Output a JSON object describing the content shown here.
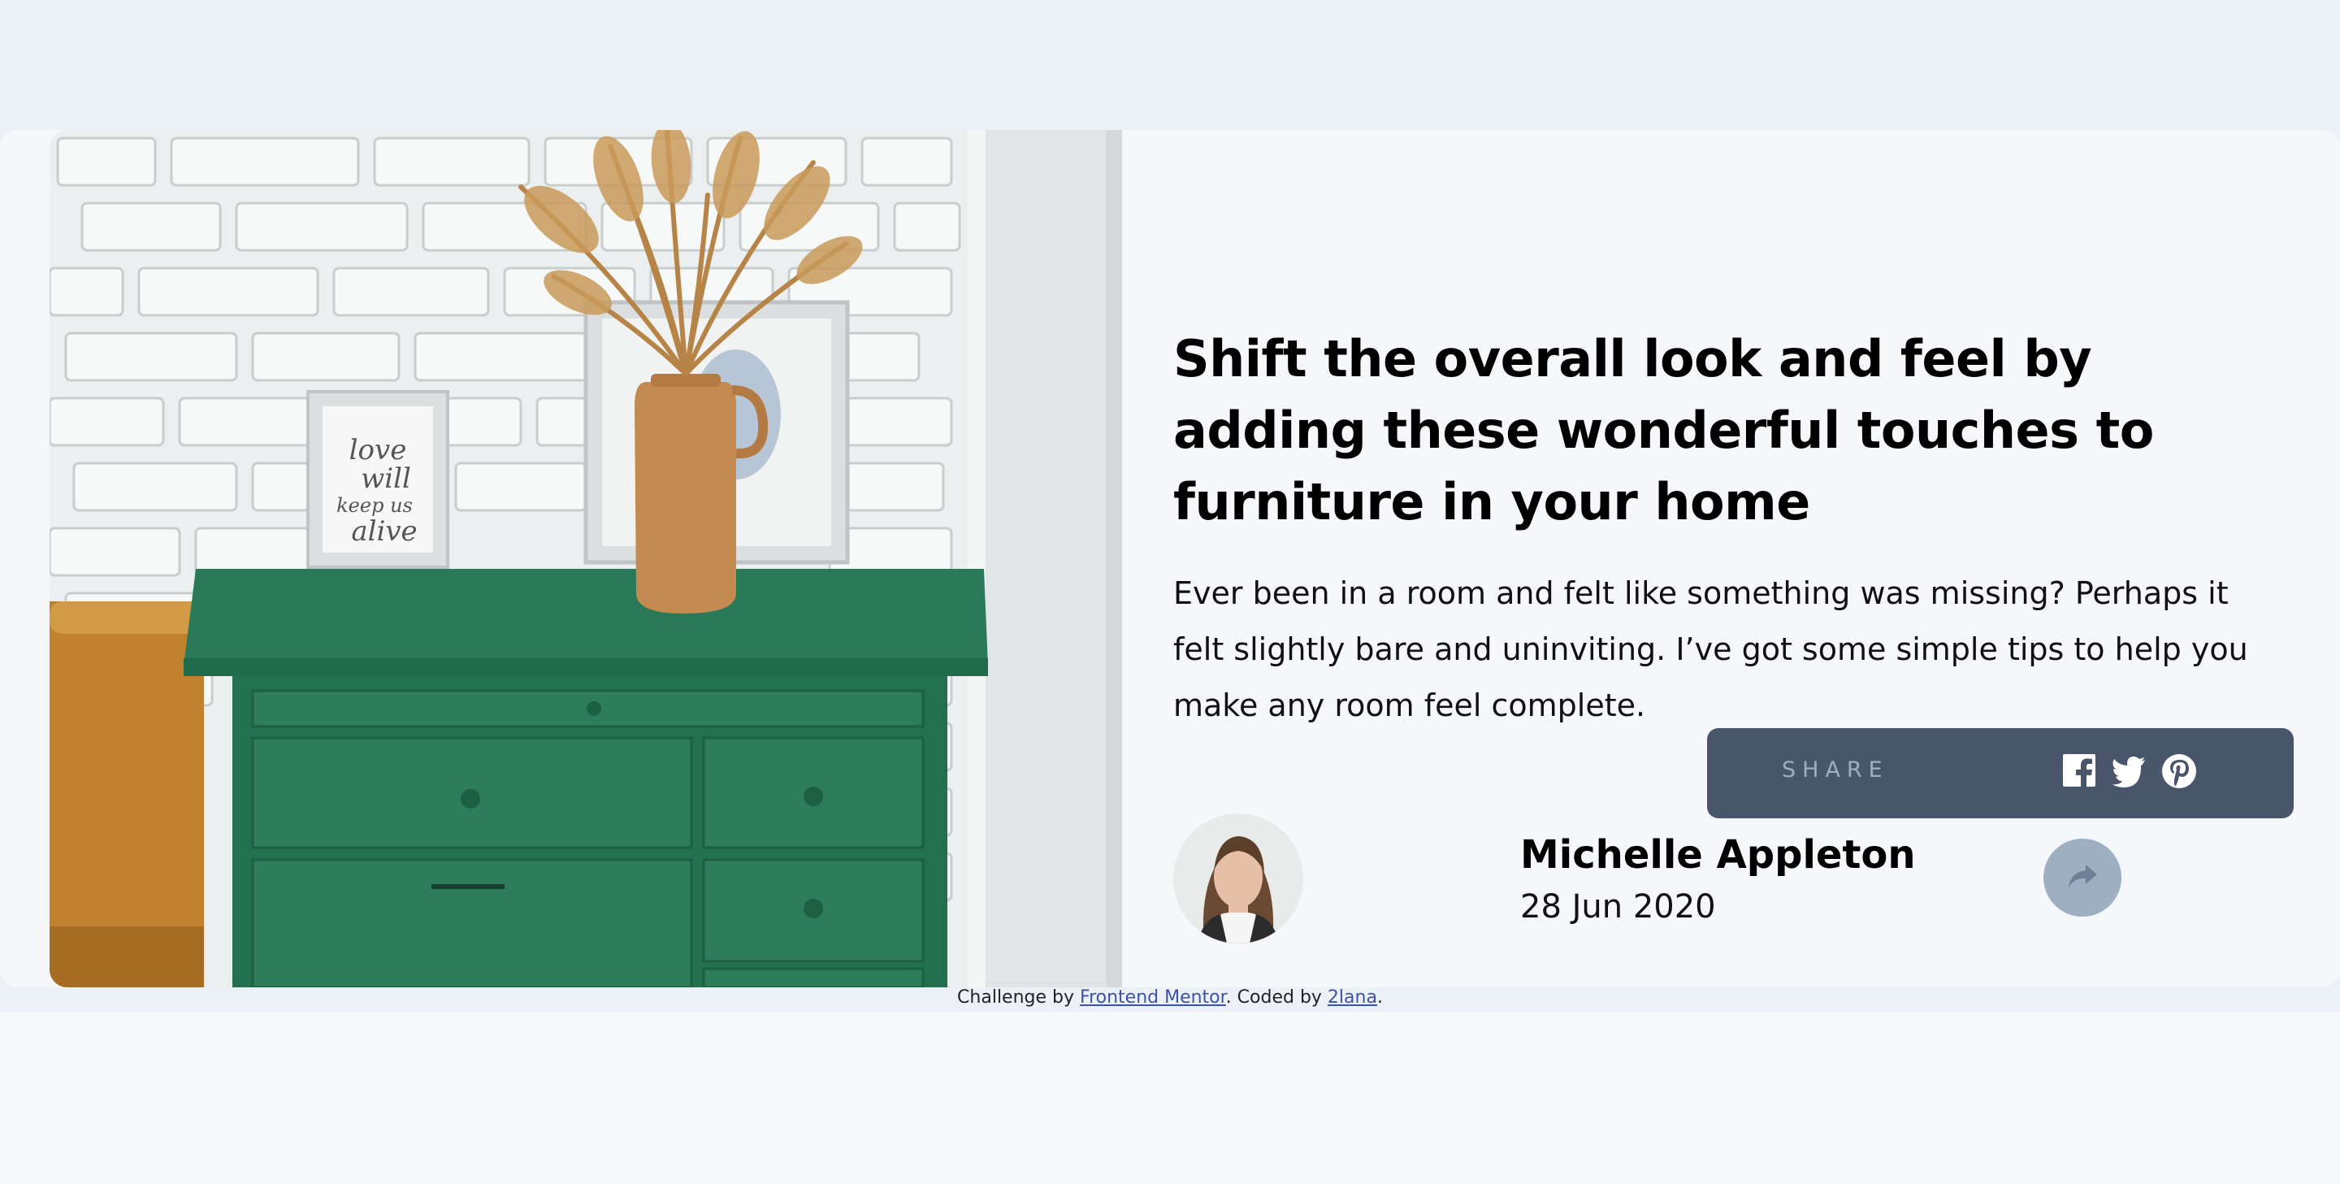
{
  "article": {
    "title": "Shift the overall look and feel by adding these wonderful touches to furniture in your home",
    "description": "Ever been in a room and felt like something was missing? Perhaps it felt slightly bare and uninviting. I’ve got some simple tips to help you make any room feel complete.",
    "image_alt": "Green painted drawers with a vase and picture frames"
  },
  "author": {
    "name": "Michelle Appleton",
    "date": "28 Jun 2020"
  },
  "share": {
    "label": "SHARE",
    "icons": [
      "facebook-icon",
      "twitter-icon",
      "pinterest-icon",
      "share-icon"
    ]
  },
  "footer": {
    "prefix": "Challenge by ",
    "mentor_link": "Frontend Mentor",
    "middle": ". Coded by ",
    "coder_link": "2lana",
    "suffix": "."
  },
  "colors": {
    "page_background": "#ecf1f8",
    "card_background": "#f5f7fa",
    "share_background": "#48556a",
    "share_accent": "#9eafc2",
    "link": "#3e52a3"
  }
}
